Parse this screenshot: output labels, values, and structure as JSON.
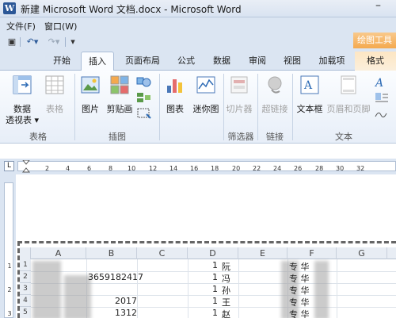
{
  "window": {
    "title": "新建 Microsoft Word 文档.docx - Microsoft Word",
    "app_icon_letter": "W",
    "minimize_glyph": "–"
  },
  "menubar": {
    "file": "文件(F)",
    "window": "窗口(W)"
  },
  "qat": {
    "save": "▣",
    "undo": "↶▾",
    "redo": "↷▾",
    "customize": "▾"
  },
  "tools_group_label": "绘图工具",
  "tabs": [
    "开始",
    "插入",
    "页面布局",
    "公式",
    "数据",
    "审阅",
    "视图",
    "加载项",
    "格式"
  ],
  "active_tab": "插入",
  "ribbon": {
    "pivot_table": "数据\n透视表",
    "pivot_line1": "数据",
    "pivot_line2": "透视表 ▾",
    "table": "表格",
    "picture": "图片",
    "clipart": "剪贴画",
    "chart": "图表",
    "sparkline": "迷你图",
    "slicer": "切片器",
    "hyperlink": "超链接",
    "textbox": "文本框",
    "header_footer": "页眉和页脚",
    "groups": {
      "tables": "表格",
      "illustrations": "插图",
      "filter": "筛选器",
      "links": "链接",
      "text": "文本"
    }
  },
  "ruler": {
    "tab_selector": "L",
    "h_ticks": [
      "2",
      "2",
      "4",
      "6",
      "8",
      "10",
      "12",
      "14",
      "16",
      "18",
      "20",
      "22",
      "24",
      "26",
      "28",
      "30",
      "32"
    ],
    "v_ticks": [
      "1",
      "2",
      "3"
    ]
  },
  "sheet": {
    "columns": [
      "A",
      "B",
      "C",
      "D",
      "E",
      "F",
      "G"
    ],
    "rows": [
      "1",
      "2",
      "3",
      "4",
      "5"
    ],
    "col_b_values": [
      "3659182417",
      "2017",
      "1312"
    ],
    "col_d_values": [
      "1",
      "1",
      "1",
      "1",
      "1"
    ],
    "col_e_values": [
      "阮",
      "冯",
      "孙",
      "王",
      "赵"
    ],
    "col_f_values": [
      "专 华",
      "专 华",
      "专 华",
      "专 华",
      "专 华"
    ]
  }
}
